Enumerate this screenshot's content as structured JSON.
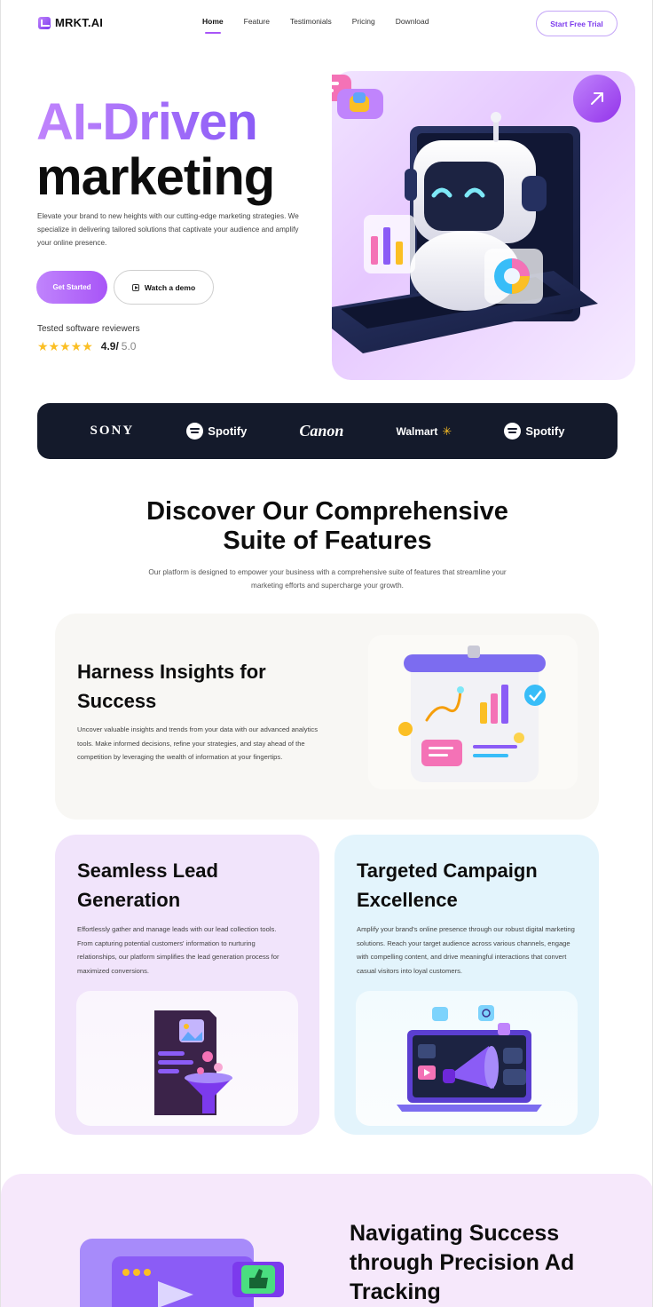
{
  "header": {
    "logo_text": "MRKT.AI",
    "nav": [
      "Home",
      "Feature",
      "Testimonials",
      "Pricing",
      "Download"
    ],
    "active_nav": "Home",
    "cta_label": "Start Free Trial"
  },
  "hero": {
    "title_line1": "AI-Driven",
    "title_line2": "marketing",
    "description": "Elevate your brand to new heights with our cutting-edge marketing strategies. We specialize in delivering tailored solutions that captivate your audience and amplify your online presence.",
    "primary_button": "Get Started",
    "secondary_button": "Watch a demo",
    "reviewers_label": "Tested software reviewers",
    "stars": "★★★★★",
    "rating": "4.9/",
    "rating_max": "5.0",
    "accent_color": "#a855f7"
  },
  "brands": [
    "SONY",
    "Spotify",
    "Canon",
    "Walmart",
    "Spotify"
  ],
  "features": {
    "title_line1": "Discover Our Comprehensive",
    "title_line2": "Suite of Features",
    "description": "Our platform is designed to empower your business with a comprehensive suite of features that streamline your marketing efforts and supercharge your growth.",
    "cards": [
      {
        "title_line1": "Harness Insights for",
        "title_line2": "Success",
        "text": "Uncover valuable insights and trends from your data with our advanced analytics tools. Make informed decisions, refine your strategies, and stay ahead of the competition by leveraging the wealth of information at your fingertips."
      },
      {
        "title_line1": "Seamless Lead",
        "title_line2": "Generation",
        "text": "Effortlessly gather and manage leads with our lead collection tools. From capturing potential customers' information to nurturing relationships, our platform simplifies the lead generation process for maximized conversions."
      },
      {
        "title_line1": "Targeted Campaign",
        "title_line2": "Excellence",
        "text": "Amplify your brand's online presence through our robust digital marketing solutions. Reach your target audience across various channels, engage with compelling content, and drive meaningful interactions that convert casual visitors into loyal customers."
      }
    ]
  },
  "tracking": {
    "title_line1": "Navigating Success",
    "title_line2": "through Precision Ad",
    "title_line3": "Tracking"
  }
}
